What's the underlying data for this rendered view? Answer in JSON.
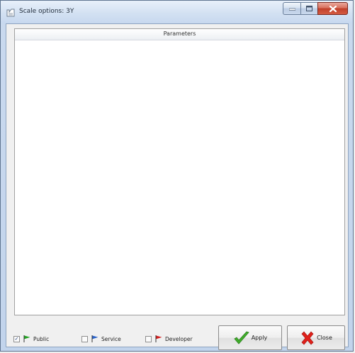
{
  "window": {
    "title": "Scale options: 3Y"
  },
  "panel": {
    "header": "Parameters"
  },
  "options": [
    {
      "label": "Public",
      "checked": true,
      "flag_color": "#22a322"
    },
    {
      "label": "Service",
      "checked": false,
      "flag_color": "#2a63c9"
    },
    {
      "label": "Developer",
      "checked": false,
      "flag_color": "#d41e1e"
    }
  ],
  "buttons": {
    "apply": "Apply",
    "close": "Close"
  },
  "icons": {
    "app": "scale-icon",
    "apply": "check-icon",
    "close": "x-icon",
    "flag": "flag-icon"
  }
}
